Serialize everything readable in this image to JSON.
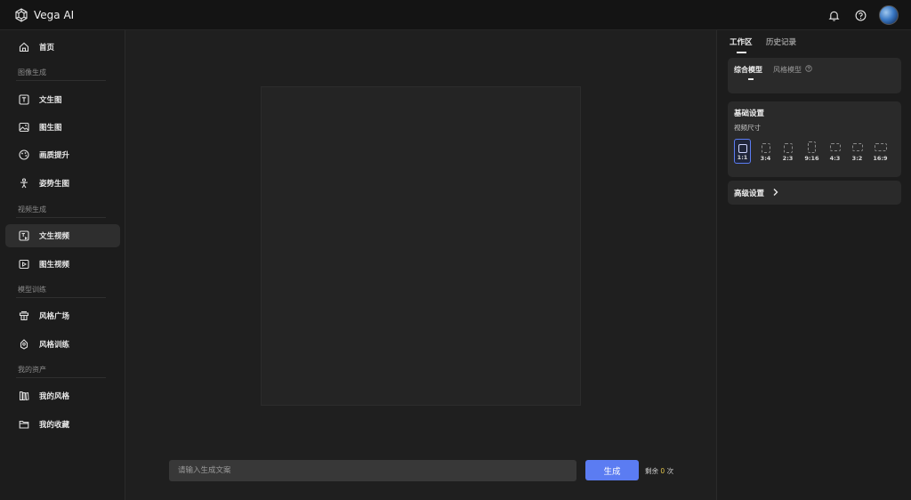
{
  "app": {
    "title": "Vega AI"
  },
  "sidebar": {
    "home": "首页",
    "sections": {
      "image": "图像生成",
      "video": "视频生成",
      "train": "模型训练",
      "assets": "我的资产"
    },
    "items": {
      "text_to_image": "文生图",
      "image_to_image": "图生图",
      "upscale": "画质提升",
      "pose": "姿势生图",
      "text_to_video": "文生视频",
      "image_to_video": "图生视频",
      "style_plaza": "风格广场",
      "style_training": "风格训练",
      "my_styles": "我的风格",
      "my_favorites": "我的收藏"
    }
  },
  "main": {
    "prompt_placeholder": "请输入生成文案",
    "generate_label": "生成",
    "remaining_prefix": "剩余",
    "remaining_count": "0",
    "remaining_suffix": "次"
  },
  "panel": {
    "tab_workspace": "工作区",
    "tab_history": "历史记录",
    "subtab_general": "综合模型",
    "subtab_style": "风格模型",
    "basic_settings": "基础设置",
    "video_size": "视频尺寸",
    "ratios": [
      "1:1",
      "3:4",
      "2:3",
      "9:16",
      "4:3",
      "3:2",
      "16:9"
    ],
    "selected_ratio": "1:1",
    "advanced_settings": "高级设置"
  },
  "colors": {
    "accent": "#5b7cf2",
    "count_highlight": "#e0c34a"
  }
}
